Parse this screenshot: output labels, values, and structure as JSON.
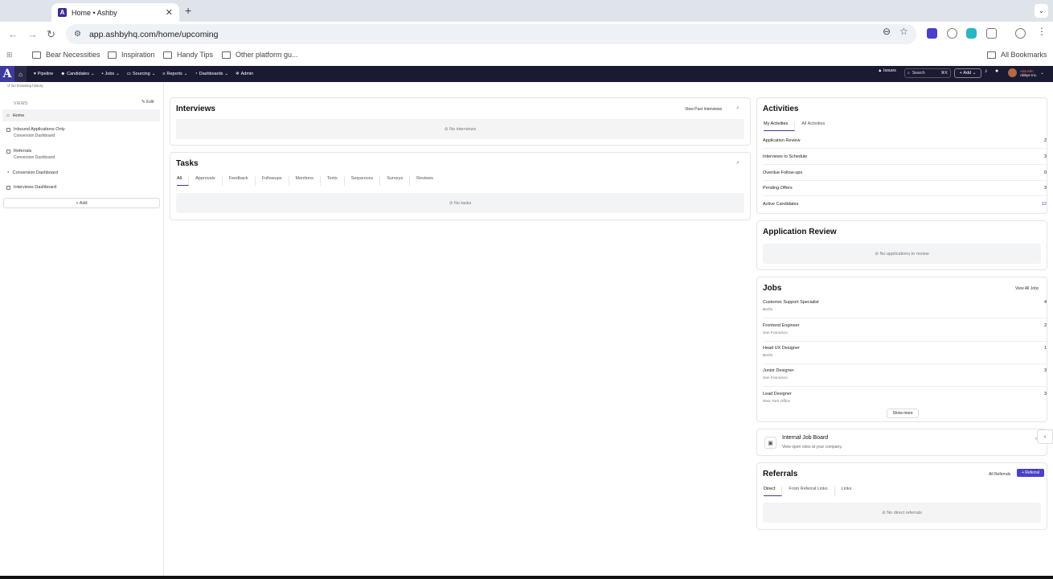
{
  "browser": {
    "tab_title": "Home • Ashby",
    "url": "app.ashbyhq.com/home/upcoming",
    "bookmarks": [
      "Bear Necessities",
      "Inspiration",
      "Handy Tips",
      "Other platform gu..."
    ],
    "all_bookmarks": "All Bookmarks"
  },
  "appnav": {
    "items": [
      "Pipeline",
      "Candidates",
      "Jobs",
      "Sourcing",
      "Reports",
      "Dashboards",
      "Admin"
    ],
    "issues": "Issues",
    "search": "Search",
    "search_shortcut": "⌘K",
    "add": "Add",
    "user_name": "Ada Min",
    "user_org": "Abbye Inc.",
    "history": "No browsing history"
  },
  "sidebar": {
    "heading": "VIEWS",
    "edit": "Edit",
    "items": [
      {
        "label": "Home",
        "sub": ""
      },
      {
        "label": "Inbound Applications Only",
        "sub": "Conversion Dashboard"
      },
      {
        "label": "Referrals",
        "sub": "Conversion Dashboard"
      },
      {
        "label": "Conversion Dashboard",
        "sub": ""
      },
      {
        "label": "Interviews Dashboard",
        "sub": ""
      }
    ],
    "add": "+ Add"
  },
  "interviews": {
    "title": "Interviews",
    "view_past": "View Past Interviews",
    "empty": "No interviews"
  },
  "tasks": {
    "title": "Tasks",
    "tabs": [
      "All",
      "Approvals",
      "Feedback",
      "Followups",
      "Mentions",
      "Texts",
      "Sequences",
      "Surveys",
      "Reviews"
    ],
    "empty": "No tasks"
  },
  "activities": {
    "title": "Activities",
    "tabs": [
      "My Activities",
      "All Activities"
    ],
    "rows": [
      {
        "label": "Application Review",
        "count": "2"
      },
      {
        "label": "Interviews to Schedule",
        "count": "3"
      },
      {
        "label": "Overdue Follow-ups",
        "count": "0"
      },
      {
        "label": "Pending Offers",
        "count": "3"
      },
      {
        "label": "Active Candidates",
        "count": "12"
      }
    ]
  },
  "app_review": {
    "title": "Application Review",
    "empty": "No applications to review"
  },
  "jobs": {
    "title": "Jobs",
    "view_all": "View All Jobs",
    "rows": [
      {
        "title": "Customer Support Specialist",
        "loc": "Berlin",
        "count": "4"
      },
      {
        "title": "Frontend Engineer",
        "loc": "San Francisco",
        "count": "2"
      },
      {
        "title": "Head UX Designer",
        "loc": "Berlin",
        "count": "1"
      },
      {
        "title": "Junior Designer",
        "loc": "San Francisco",
        "count": "3"
      },
      {
        "title": "Lead Designer",
        "loc": "New York Office",
        "count": "3"
      }
    ],
    "show_more": "Show more"
  },
  "job_board": {
    "title": "Internal Job Board",
    "sub": "View open roles at your company."
  },
  "referrals": {
    "title": "Referrals",
    "all": "All Referrals",
    "add": "+ Referral",
    "tabs": [
      "Direct",
      "From Referral Links",
      "Links"
    ],
    "empty": "No direct referrals"
  }
}
